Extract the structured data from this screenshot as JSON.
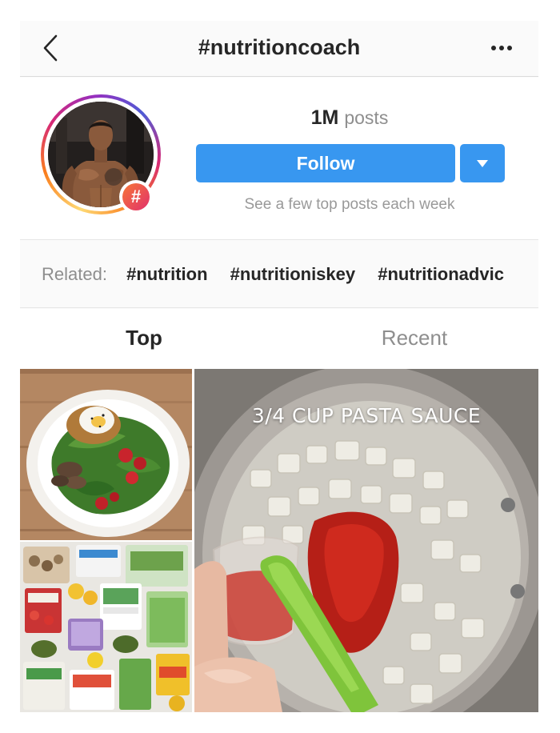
{
  "header": {
    "title": "#nutritioncoach",
    "back_icon": "chevron-left-icon",
    "more_icon": "more-horizontal-icon"
  },
  "profile": {
    "post_count": "1M",
    "post_label": "posts",
    "follow_label": "Follow",
    "dropdown_icon": "caret-down-icon",
    "hint": "See a few top posts each week",
    "badge_symbol": "#"
  },
  "related": {
    "label": "Related:",
    "tags": [
      "#nutrition",
      "#nutritioniskey",
      "#nutritionadvic"
    ]
  },
  "tabs": {
    "top": "Top",
    "recent": "Recent",
    "active": "Top"
  },
  "grid": {
    "video_caption": "3/4 CUP PASTA SAUCE"
  },
  "colors": {
    "accent": "#3897f0",
    "text": "#262626",
    "muted": "#8e8e8e",
    "badge": "#e1306c"
  }
}
